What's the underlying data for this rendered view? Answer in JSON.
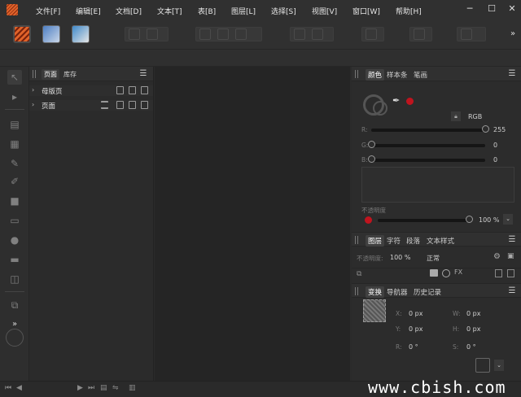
{
  "menu": [
    "文件[F]",
    "编辑[E]",
    "文档[D]",
    "文本[T]",
    "表[B]",
    "图层[L]",
    "选择[S]",
    "视图[V]",
    "窗口[W]",
    "帮助[H]"
  ],
  "window_controls": {
    "minimize": "─",
    "maximize": "☐",
    "close": "✕"
  },
  "toolbar": {
    "more": "»"
  },
  "pages_panel": {
    "tabs": [
      "页面",
      "库存"
    ],
    "rows": [
      {
        "chevron": "›",
        "label": "母版页"
      },
      {
        "chevron": "›",
        "label": "页面"
      }
    ]
  },
  "tools_panel": {
    "more": "»"
  },
  "color_panel": {
    "tabs": [
      "颜色",
      "样本条",
      "笔画"
    ],
    "mode": "RGB",
    "channels": [
      {
        "label": "R:",
        "value": "255",
        "fraction": 1.0
      },
      {
        "label": "G:",
        "value": "0",
        "fraction": 0.0
      },
      {
        "label": "B:",
        "value": "0",
        "fraction": 0.0
      }
    ],
    "opacity_label": "不透明度",
    "opacity_value": "100 %",
    "opacity_fraction": 1.0,
    "swatch_color": "#c0141e"
  },
  "layers_panel": {
    "tabs": [
      "图层",
      "字符",
      "段落",
      "文本样式"
    ],
    "opacity_label": "不透明度:",
    "opacity_value": "100 %",
    "blend_mode": "正常"
  },
  "transform_panel": {
    "tabs": [
      "变换",
      "导航器",
      "历史记录"
    ],
    "fields": [
      {
        "label": "X:",
        "value": "0 px"
      },
      {
        "label": "W:",
        "value": "0 px"
      },
      {
        "label": "Y:",
        "value": "0 px"
      },
      {
        "label": "H:",
        "value": "0 px"
      },
      {
        "label": "R:",
        "value": "0 °"
      },
      {
        "label": "S:",
        "value": "0 °"
      }
    ]
  },
  "watermark": "www.cbish.com",
  "colors": {
    "accent": "#e0632a",
    "red": "#c0141e"
  }
}
